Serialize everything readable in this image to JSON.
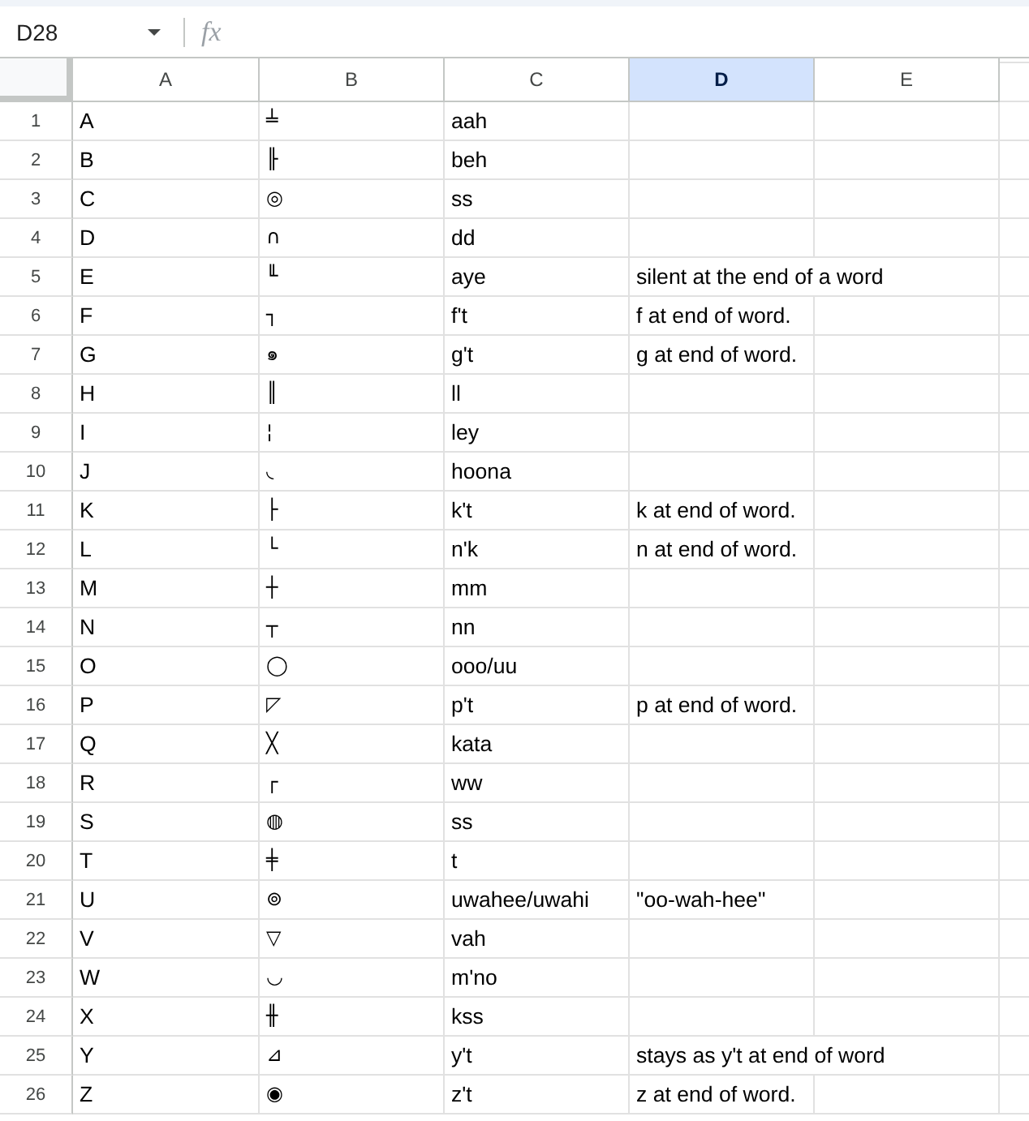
{
  "name_box": {
    "value": "D28"
  },
  "formula_bar": {
    "label": "fx"
  },
  "columns": [
    {
      "label": "A",
      "selected": false
    },
    {
      "label": "B",
      "selected": false
    },
    {
      "label": "C",
      "selected": false
    },
    {
      "label": "D",
      "selected": true
    },
    {
      "label": "E",
      "selected": false
    }
  ],
  "rows": [
    {
      "number": "1",
      "selected": false,
      "cells": [
        "A",
        "╧",
        "aah"
      ]
    },
    {
      "number": "2",
      "selected": false,
      "cells": [
        "B",
        "╟",
        "beh"
      ]
    },
    {
      "number": "3",
      "selected": false,
      "cells": [
        "C",
        "◎",
        "ss"
      ]
    },
    {
      "number": "4",
      "selected": false,
      "cells": [
        "D",
        "∩",
        "dd"
      ]
    },
    {
      "number": "5",
      "selected": false,
      "cells": [
        "E",
        "╙",
        "aye",
        "silent at the end of a word"
      ]
    },
    {
      "number": "6",
      "selected": false,
      "cells": [
        "F",
        "┐",
        "f't",
        "f at end of word."
      ]
    },
    {
      "number": "7",
      "selected": false,
      "cells": [
        "G",
        "๑",
        "g't",
        "g at end of word."
      ]
    },
    {
      "number": "8",
      "selected": false,
      "cells": [
        "H",
        "║",
        "ll"
      ]
    },
    {
      "number": "9",
      "selected": false,
      "cells": [
        "I",
        "¦",
        "ley"
      ]
    },
    {
      "number": "10",
      "selected": false,
      "cells": [
        "J",
        "◟",
        "hoona"
      ]
    },
    {
      "number": "11",
      "selected": false,
      "cells": [
        "K",
        "├",
        "k't",
        "k at end of word."
      ]
    },
    {
      "number": "12",
      "selected": false,
      "cells": [
        "L",
        "└",
        "n'k",
        "n at end of word."
      ]
    },
    {
      "number": "13",
      "selected": false,
      "cells": [
        "M",
        "┼",
        "mm"
      ]
    },
    {
      "number": "14",
      "selected": false,
      "cells": [
        "N",
        "┬",
        "nn"
      ]
    },
    {
      "number": "15",
      "selected": false,
      "cells": [
        "O",
        "◯",
        "ooo/uu"
      ]
    },
    {
      "number": "16",
      "selected": false,
      "cells": [
        "P",
        "◸",
        "p't",
        "p at end of word."
      ]
    },
    {
      "number": "17",
      "selected": false,
      "cells": [
        "Q",
        "╳",
        "kata"
      ]
    },
    {
      "number": "18",
      "selected": false,
      "cells": [
        "R",
        "┌",
        "ww"
      ]
    },
    {
      "number": "19",
      "selected": false,
      "cells": [
        "S",
        "◍",
        "ss"
      ]
    },
    {
      "number": "20",
      "selected": false,
      "cells": [
        "T",
        "╪",
        "t"
      ]
    },
    {
      "number": "21",
      "selected": false,
      "cells": [
        "U",
        "⊚",
        "uwahee/uwahi",
        "\"oo-wah-hee\""
      ]
    },
    {
      "number": "22",
      "selected": false,
      "cells": [
        "V",
        "▽",
        "vah"
      ]
    },
    {
      "number": "23",
      "selected": false,
      "cells": [
        "W",
        "◡",
        "m'no"
      ]
    },
    {
      "number": "24",
      "selected": false,
      "cells": [
        "X",
        "╫",
        "kss"
      ]
    },
    {
      "number": "25",
      "selected": false,
      "cells": [
        "Y",
        "⊿",
        "y't",
        "stays as y't at end of word"
      ]
    },
    {
      "number": "26",
      "selected": false,
      "cells": [
        "Z",
        "◉",
        "z't",
        "z at end of word."
      ]
    }
  ]
}
